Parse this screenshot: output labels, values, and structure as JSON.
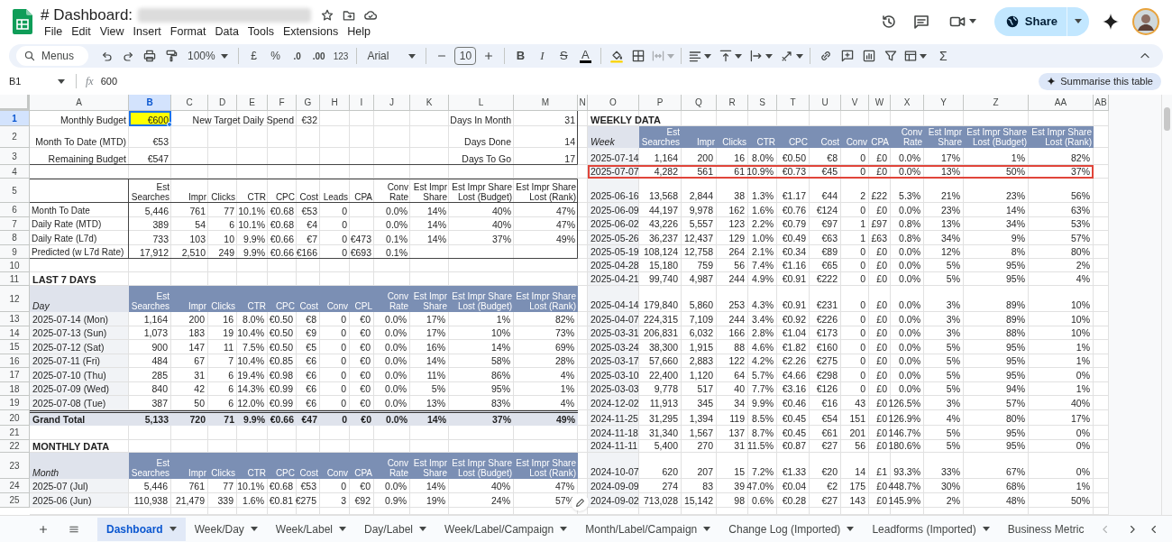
{
  "app": {
    "title": "# Dashboard:",
    "menus": [
      "File",
      "Edit",
      "View",
      "Insert",
      "Format",
      "Data",
      "Tools",
      "Extensions",
      "Help"
    ],
    "share_button": "Share"
  },
  "toolbar": {
    "search_placeholder": "Menus",
    "zoom": "100%",
    "currency": "£",
    "percent": "%",
    "decrease_decimals": ".0",
    "increase_decimals": ".00",
    "number_format": "123",
    "font": "Arial",
    "font_size": "10",
    "bold": "B",
    "italic": "I",
    "strikethrough": "S",
    "text_color": "A",
    "functions": "Σ"
  },
  "formula_bar": {
    "cell_ref": "B1",
    "function_label": "fx",
    "formula": "600",
    "summarise_button": "Summarise this table"
  },
  "column_headers": [
    {
      "label": "A",
      "selected": false
    },
    {
      "label": "B",
      "selected": true
    },
    {
      "label": "C",
      "selected": false
    },
    {
      "label": "D",
      "selected": false
    },
    {
      "label": "E",
      "selected": false
    },
    {
      "label": "F",
      "selected": false
    },
    {
      "label": "G",
      "selected": false
    },
    {
      "label": "H",
      "selected": false
    },
    {
      "label": "I",
      "selected": false
    },
    {
      "label": "J",
      "selected": false
    },
    {
      "label": "K",
      "selected": false
    },
    {
      "label": "L",
      "selected": false
    },
    {
      "label": "M",
      "selected": false
    },
    {
      "label": "N",
      "selected": false
    },
    {
      "label": "O",
      "selected": false
    },
    {
      "label": "P",
      "selected": false
    },
    {
      "label": "Q",
      "selected": false
    },
    {
      "label": "R",
      "selected": false
    },
    {
      "label": "S",
      "selected": false
    },
    {
      "label": "T",
      "selected": false
    },
    {
      "label": "U",
      "selected": false
    },
    {
      "label": "V",
      "selected": false
    },
    {
      "label": "W",
      "selected": false
    },
    {
      "label": "X",
      "selected": false
    },
    {
      "label": "Y",
      "selected": false
    },
    {
      "label": "Z",
      "selected": false
    },
    {
      "label": "AA",
      "selected": false
    },
    {
      "label": "AB",
      "selected": false
    }
  ],
  "row_headers": [
    {
      "label": "1",
      "selected": true
    },
    {
      "label": "2",
      "selected": false
    },
    {
      "label": "3",
      "selected": false
    },
    {
      "label": "4",
      "selected": false
    },
    {
      "label": "5",
      "selected": false
    },
    {
      "label": "6",
      "selected": false
    },
    {
      "label": "7",
      "selected": false
    },
    {
      "label": "8",
      "selected": false
    },
    {
      "label": "9",
      "selected": false
    },
    {
      "label": "10",
      "selected": false
    },
    {
      "label": "11",
      "selected": false
    },
    {
      "label": "12",
      "selected": false
    },
    {
      "label": "13",
      "selected": false
    },
    {
      "label": "14",
      "selected": false
    },
    {
      "label": "15",
      "selected": false
    },
    {
      "label": "16",
      "selected": false
    },
    {
      "label": "17",
      "selected": false
    },
    {
      "label": "18",
      "selected": false
    },
    {
      "label": "19",
      "selected": false
    },
    {
      "label": "20",
      "selected": false
    },
    {
      "label": "21",
      "selected": false
    },
    {
      "label": "22",
      "selected": false
    },
    {
      "label": "23",
      "selected": false
    },
    {
      "label": "24",
      "selected": false
    },
    {
      "label": "25",
      "selected": false
    }
  ],
  "budget": [
    {
      "label": "Monthly Budget",
      "value": "€600",
      "highlighted": true,
      "selected": true
    },
    {
      "label": "Month To Date (MTD)",
      "value": "€53",
      "highlighted": false,
      "selected": false
    },
    {
      "label": "Remaining Budget",
      "value": "€547",
      "highlighted": false,
      "selected": false
    }
  ],
  "target": {
    "label": "New Target Daily Spend",
    "value": "€32"
  },
  "days": [
    {
      "label": "Days In Month",
      "value": "31"
    },
    {
      "label": "Days Done",
      "value": "14"
    },
    {
      "label": "Days To Go",
      "value": "17"
    }
  ],
  "metrics_table": {
    "columns": [
      "Est\nSearches",
      "Impr",
      "Clicks",
      "CTR",
      "CPC",
      "Cost",
      "Leads",
      "CPA",
      "Conv\nRate",
      "Est Impr\nShare",
      "Est Impr Share\nLost (Budget)",
      "Est Impr Share\nLost (Rank)"
    ],
    "rows": [
      {
        "label": "Month To Date",
        "est_searches": "5,446",
        "impr": "761",
        "clicks": "77",
        "ctr": "10.1%",
        "cpc": "€0.68",
        "cost": "€53",
        "leads": "0",
        "conv_rate": "0.0%",
        "est_impr_share": "14%",
        "lost_budget": "40%",
        "lost_rank": "47%"
      },
      {
        "label": "Daily Rate (MTD)",
        "est_searches": "389",
        "impr": "54",
        "clicks": "6",
        "ctr": "10.1%",
        "cpc": "€0.68",
        "cost": "€4",
        "leads": "0",
        "conv_rate": "0.0%",
        "est_impr_share": "14%",
        "lost_budget": "40%",
        "lost_rank": "47%"
      },
      {
        "label": "Daily Rate (L7d)",
        "est_searches": "733",
        "impr": "103",
        "clicks": "10",
        "ctr": "9.9%",
        "cpc": "€0.66",
        "cost": "€7",
        "leads": "0",
        "cpa": "€473",
        "conv_rate": "0.1%",
        "est_impr_share": "14%",
        "lost_budget": "37%",
        "lost_rank": "49%"
      },
      {
        "label": "Predicted (w L7d Rate)",
        "est_searches": "17,912",
        "impr": "2,510",
        "clicks": "249",
        "ctr": "9.9%",
        "cpc": "€0.66",
        "cost": "€166",
        "leads": "0",
        "cpa": "€693",
        "conv_rate": "0.1%"
      }
    ]
  },
  "last_7_days": {
    "title": "LAST 7 DAYS",
    "first_column": "Day",
    "columns": [
      "Est\nSearches",
      "Impr",
      "Clicks",
      "CTR",
      "CPC",
      "Cost",
      "Conv",
      "CPL",
      "Conv\nRate",
      "Est Impr\nShare",
      "Est Impr Share\nLost (Budget)",
      "Est Impr Share\nLost (Rank)"
    ],
    "rows": [
      {
        "label": "2025-07-14 (Mon)",
        "values": [
          "1,164",
          "200",
          "16",
          "8.0%",
          "€0.50",
          "€8",
          "0",
          "€0",
          "0.0%",
          "17%",
          "1%",
          "82%"
        ]
      },
      {
        "label": "2025-07-13 (Sun)",
        "values": [
          "1,073",
          "183",
          "19",
          "10.4%",
          "€0.50",
          "€9",
          "0",
          "€0",
          "0.0%",
          "17%",
          "10%",
          "73%"
        ]
      },
      {
        "label": "2025-07-12 (Sat)",
        "values": [
          "900",
          "147",
          "11",
          "7.5%",
          "€0.50",
          "€5",
          "0",
          "€0",
          "0.0%",
          "16%",
          "14%",
          "69%"
        ]
      },
      {
        "label": "2025-07-11 (Fri)",
        "values": [
          "484",
          "67",
          "7",
          "10.4%",
          "€0.85",
          "€6",
          "0",
          "€0",
          "0.0%",
          "14%",
          "58%",
          "28%"
        ]
      },
      {
        "label": "2025-07-10 (Thu)",
        "values": [
          "285",
          "31",
          "6",
          "19.4%",
          "€0.98",
          "€6",
          "0",
          "€0",
          "0.0%",
          "11%",
          "86%",
          "4%"
        ]
      },
      {
        "label": "2025-07-09 (Wed)",
        "values": [
          "840",
          "42",
          "6",
          "14.3%",
          "€0.99",
          "€6",
          "0",
          "€0",
          "0.0%",
          "5%",
          "95%",
          "1%"
        ]
      },
      {
        "label": "2025-07-08 (Tue)",
        "values": [
          "387",
          "50",
          "6",
          "12.0%",
          "€0.99",
          "€6",
          "0",
          "€0",
          "0.0%",
          "13%",
          "83%",
          "4%"
        ]
      }
    ],
    "total": {
      "label": "Grand Total",
      "values": [
        "5,133",
        "720",
        "71",
        "9.9%",
        "€0.66",
        "€47",
        "0",
        "€0",
        "0.0%",
        "14%",
        "37%",
        "49%"
      ]
    }
  },
  "monthly_data": {
    "title": "MONTHLY DATA",
    "first_column": "Month",
    "columns": [
      "Est\nSearches",
      "Impr",
      "Clicks",
      "CTR",
      "CPC",
      "Cost",
      "Conv",
      "CPA",
      "Conv\nRate",
      "Est Impr\nShare",
      "Est Impr Share\nLost (Budget)",
      "Est Impr Share\nLost (Rank)"
    ],
    "rows": [
      {
        "label": "2025-07 (Jul)",
        "values": [
          "5,446",
          "761",
          "77",
          "10.1%",
          "€0.68",
          "€53",
          "0",
          "€0",
          "0.0%",
          "14%",
          "40%",
          "47%"
        ]
      },
      {
        "label": "2025-06 (Jun)",
        "values": [
          "110,938",
          "21,479",
          "339",
          "1.6%",
          "€0.81",
          "€275",
          "3",
          "€92",
          "0.9%",
          "19%",
          "24%",
          "57%"
        ]
      }
    ]
  },
  "weekly_data": {
    "title": "WEEKLY DATA",
    "first_column": "Week",
    "columns": [
      "Est\nSearches",
      "Impr",
      "Clicks",
      "CTR",
      "CPC",
      "Cost",
      "Conv",
      "CPA",
      "Conv\nRate",
      "Est Impr\nShare",
      "Est Impr Share\nLost (Budget)",
      "Est Impr Share\nLost (Rank)"
    ],
    "rows": [
      {
        "label": "2025-07-14",
        "highlighted": false,
        "values": [
          "1,164",
          "200",
          "16",
          "8.0%",
          "€0.50",
          "€8",
          "0",
          "£0",
          "0.0%",
          "17%",
          "1%",
          "82%"
        ]
      },
      {
        "label": "2025-07-07",
        "highlighted": true,
        "values": [
          "4,282",
          "561",
          "61",
          "10.9%",
          "€0.73",
          "€45",
          "0",
          "£0",
          "0.0%",
          "13%",
          "50%",
          "37%"
        ]
      },
      {
        "label": "2025-06-16",
        "highlighted": false,
        "values": [
          "13,568",
          "2,844",
          "38",
          "1.3%",
          "€1.17",
          "€44",
          "2",
          "£22",
          "5.3%",
          "21%",
          "23%",
          "56%"
        ]
      },
      {
        "label": "2025-06-09",
        "highlighted": false,
        "values": [
          "44,197",
          "9,978",
          "162",
          "1.6%",
          "€0.76",
          "€124",
          "0",
          "£0",
          "0.0%",
          "23%",
          "14%",
          "63%"
        ]
      },
      {
        "label": "2025-06-02",
        "highlighted": false,
        "values": [
          "43,226",
          "5,557",
          "123",
          "2.2%",
          "€0.79",
          "€97",
          "1",
          "£97",
          "0.8%",
          "13%",
          "34%",
          "53%"
        ]
      },
      {
        "label": "2025-05-26",
        "highlighted": false,
        "values": [
          "36,237",
          "12,437",
          "129",
          "1.0%",
          "€0.49",
          "€63",
          "1",
          "£63",
          "0.8%",
          "34%",
          "9%",
          "57%"
        ]
      },
      {
        "label": "2025-05-19",
        "highlighted": false,
        "values": [
          "108,124",
          "12,758",
          "264",
          "2.1%",
          "€0.34",
          "€89",
          "0",
          "£0",
          "0.0%",
          "12%",
          "8%",
          "80%"
        ]
      },
      {
        "label": "2025-04-28",
        "highlighted": false,
        "values": [
          "15,180",
          "759",
          "56",
          "7.4%",
          "€1.16",
          "€65",
          "0",
          "£0",
          "0.0%",
          "5%",
          "95%",
          "2%"
        ]
      },
      {
        "label": "2025-04-21",
        "highlighted": false,
        "values": [
          "99,740",
          "4,987",
          "244",
          "4.9%",
          "€0.91",
          "€222",
          "0",
          "£0",
          "0.0%",
          "5%",
          "95%",
          "4%"
        ]
      },
      {
        "label": "2025-04-14",
        "highlighted": false,
        "values": [
          "179,840",
          "5,860",
          "253",
          "4.3%",
          "€0.91",
          "€231",
          "0",
          "£0",
          "0.0%",
          "3%",
          "89%",
          "10%"
        ]
      },
      {
        "label": "2025-04-07",
        "highlighted": false,
        "values": [
          "224,315",
          "7,109",
          "244",
          "3.4%",
          "€0.92",
          "€226",
          "0",
          "£0",
          "0.0%",
          "3%",
          "89%",
          "10%"
        ]
      },
      {
        "label": "2025-03-31",
        "highlighted": false,
        "values": [
          "206,831",
          "6,032",
          "166",
          "2.8%",
          "€1.04",
          "€173",
          "0",
          "£0",
          "0.0%",
          "3%",
          "88%",
          "10%"
        ]
      },
      {
        "label": "2025-03-24",
        "highlighted": false,
        "values": [
          "38,300",
          "1,915",
          "88",
          "4.6%",
          "€1.82",
          "€160",
          "0",
          "£0",
          "0.0%",
          "5%",
          "95%",
          "1%"
        ]
      },
      {
        "label": "2025-03-17",
        "highlighted": false,
        "values": [
          "57,660",
          "2,883",
          "122",
          "4.2%",
          "€2.26",
          "€275",
          "0",
          "£0",
          "0.0%",
          "5%",
          "95%",
          "1%"
        ]
      },
      {
        "label": "2025-03-10",
        "highlighted": false,
        "values": [
          "22,400",
          "1,120",
          "64",
          "5.7%",
          "€4.66",
          "€298",
          "0",
          "£0",
          "0.0%",
          "5%",
          "95%",
          "0%"
        ]
      },
      {
        "label": "2025-03-03",
        "highlighted": false,
        "values": [
          "9,778",
          "517",
          "40",
          "7.7%",
          "€3.16",
          "€126",
          "0",
          "£0",
          "0.0%",
          "5%",
          "94%",
          "1%"
        ]
      },
      {
        "label": "2024-12-02",
        "highlighted": false,
        "values": [
          "11,913",
          "345",
          "34",
          "9.9%",
          "€0.46",
          "€16",
          "43",
          "£0",
          "126.5%",
          "3%",
          "57%",
          "40%"
        ]
      },
      {
        "label": "2024-11-25",
        "highlighted": false,
        "values": [
          "31,295",
          "1,394",
          "119",
          "8.5%",
          "€0.45",
          "€54",
          "151",
          "£0",
          "126.9%",
          "4%",
          "80%",
          "17%"
        ]
      },
      {
        "label": "2024-11-18",
        "highlighted": false,
        "values": [
          "31,340",
          "1,567",
          "137",
          "8.7%",
          "€0.45",
          "€61",
          "201",
          "£0",
          "146.7%",
          "5%",
          "95%",
          "0%"
        ]
      },
      {
        "label": "2024-11-11",
        "highlighted": false,
        "values": [
          "5,400",
          "270",
          "31",
          "11.5%",
          "€0.87",
          "€27",
          "56",
          "£0",
          "180.6%",
          "5%",
          "95%",
          "0%"
        ]
      },
      {
        "label": "2024-10-07",
        "highlighted": false,
        "values": [
          "620",
          "207",
          "15",
          "7.2%",
          "€1.33",
          "€20",
          "14",
          "£1",
          "93.3%",
          "33%",
          "67%",
          "0%"
        ]
      },
      {
        "label": "2024-09-09",
        "highlighted": false,
        "values": [
          "274",
          "83",
          "39",
          "47.0%",
          "€0.04",
          "€2",
          "175",
          "£0",
          "448.7%",
          "30%",
          "68%",
          "1%"
        ]
      },
      {
        "label": "2024-09-02",
        "highlighted": false,
        "values": [
          "713,028",
          "15,142",
          "98",
          "0.6%",
          "€0.28",
          "€27",
          "143",
          "£0",
          "145.9%",
          "2%",
          "48%",
          "50%"
        ]
      }
    ]
  },
  "sheet_tabs": [
    {
      "label": "Dashboard",
      "selected": true,
      "cut": false
    },
    {
      "label": "Week/Day",
      "selected": false,
      "cut": false
    },
    {
      "label": "Week/Label",
      "selected": false,
      "cut": false
    },
    {
      "label": "Day/Label",
      "selected": false,
      "cut": false
    },
    {
      "label": "Week/Label/Campaign",
      "selected": false,
      "cut": false
    },
    {
      "label": "Month/Label/Campaign",
      "selected": false,
      "cut": false
    },
    {
      "label": "Change Log (Imported)",
      "selected": false,
      "cut": false
    },
    {
      "label": "Leadforms (Imported)",
      "selected": false,
      "cut": false
    },
    {
      "label": "Business Metric",
      "selected": false,
      "cut": true
    }
  ]
}
